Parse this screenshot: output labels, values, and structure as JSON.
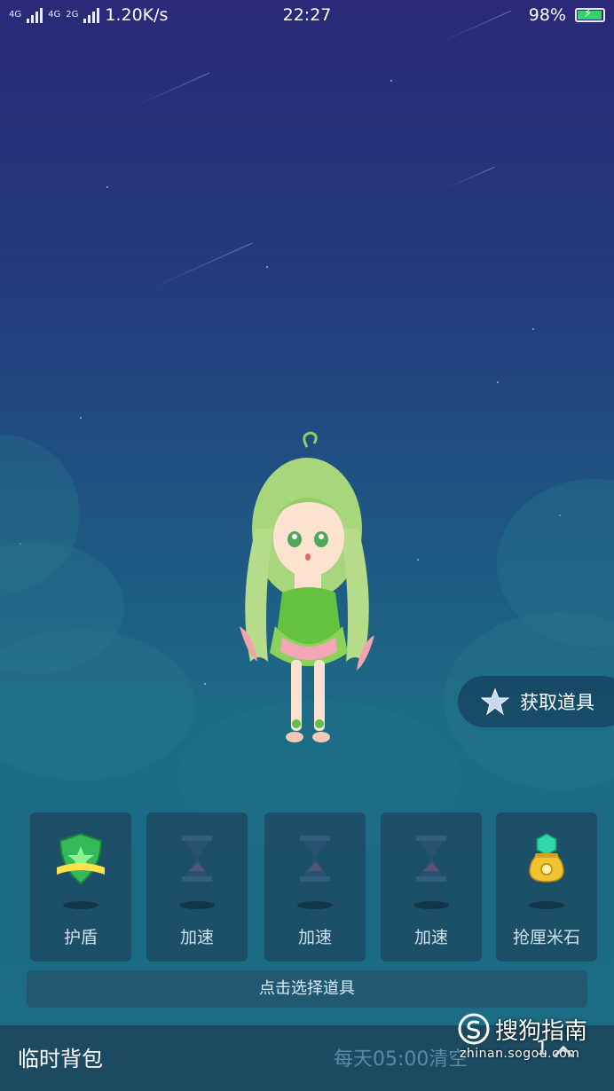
{
  "status_bar": {
    "network_labels": [
      "4G",
      "4G",
      "2G"
    ],
    "speed": "1.20K/s",
    "time": "22:27",
    "battery": "98%"
  },
  "colors": {
    "background_top": "#2a2a78",
    "background_bottom": "#1b6c84",
    "battery": "#36d16d",
    "shield": "#33b85a",
    "coin_bag": "#f2c230",
    "gem": "#2fd6a8"
  },
  "get_items": {
    "icon": "star-icon",
    "label": "获取道具"
  },
  "slots": [
    {
      "name": "护盾",
      "icon": "shield-icon"
    },
    {
      "name": "加速",
      "icon": "hourglass-icon"
    },
    {
      "name": "加速",
      "icon": "hourglass-icon"
    },
    {
      "name": "加速",
      "icon": "hourglass-icon"
    },
    {
      "name": "抢厘米石",
      "icon": "gem-bag-icon"
    }
  ],
  "select_hint": "点击选择道具",
  "bottom_bar": {
    "title": "临时背包",
    "reset_text": "每天05:00清空",
    "count": "1",
    "expand_icon": "chevron-up-icon"
  },
  "watermark": {
    "brand": "搜狗指南",
    "url": "zhinan.sogou.com"
  }
}
